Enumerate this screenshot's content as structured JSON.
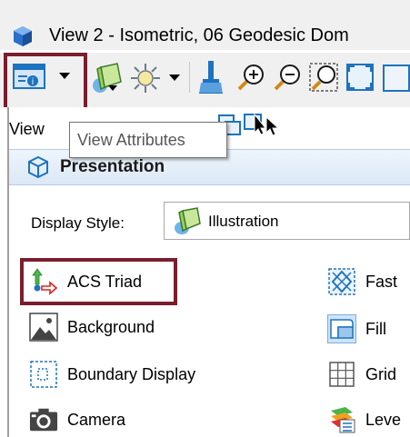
{
  "window": {
    "title": "View 2 - Isometric, 06 Geodesic Dom"
  },
  "toolbar": {
    "buttons": [
      {
        "name": "view-attributes",
        "icon": "view-attributes-icon",
        "has_dropdown": true,
        "highlighted": true
      },
      {
        "name": "display-style",
        "icon": "cube-icon",
        "has_dropdown": true
      },
      {
        "name": "lights",
        "icon": "sun-icon",
        "has_dropdown": true
      },
      {
        "name": "clear",
        "icon": "brush-icon"
      },
      {
        "name": "zoom-in",
        "icon": "zoom-in-icon"
      },
      {
        "name": "zoom-out",
        "icon": "zoom-out-icon"
      },
      {
        "name": "window-area",
        "icon": "window-area-icon"
      },
      {
        "name": "fit-view",
        "icon": "fit-view-icon"
      }
    ]
  },
  "tooltip": {
    "text": "View Attributes"
  },
  "panel": {
    "tab_label": "View",
    "section_title": "Presentation",
    "display_style": {
      "label": "Display Style:",
      "value": "Illustration"
    },
    "left_items": [
      {
        "label": "ACS Triad",
        "icon": "acs-triad-icon",
        "highlighted": true
      },
      {
        "label": "Background",
        "icon": "background-icon"
      },
      {
        "label": "Boundary Display",
        "icon": "boundary-display-icon"
      },
      {
        "label": "Camera",
        "icon": "camera-icon"
      }
    ],
    "right_items": [
      {
        "label": "Fast",
        "icon": "fast-icon"
      },
      {
        "label": "Fill",
        "icon": "fill-icon",
        "selected": true
      },
      {
        "label": "Grid",
        "icon": "grid-icon"
      },
      {
        "label": "Leve",
        "icon": "levels-icon"
      }
    ]
  },
  "colors": {
    "highlight": "#7a1e2e",
    "accent": "#1e73be",
    "section_bg": "#dbe8f6"
  }
}
